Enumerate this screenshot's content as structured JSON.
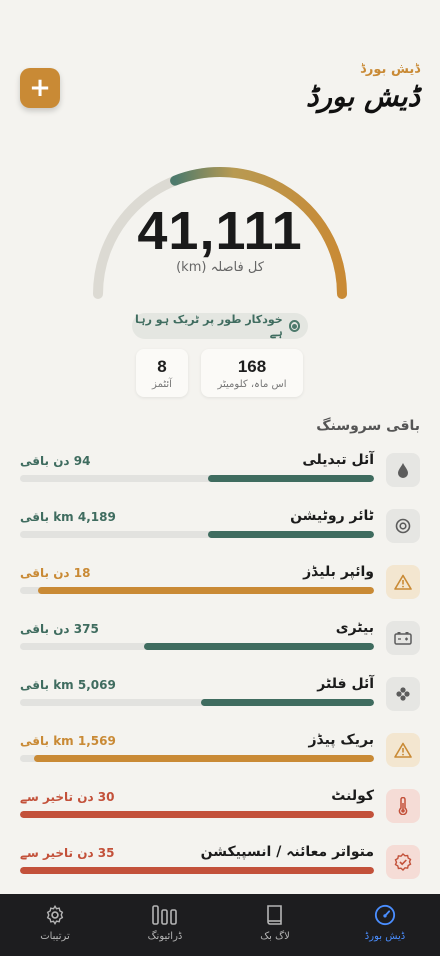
{
  "header": {
    "small_title": "ڈیش بورڈ",
    "title": "ڈیش بورڈ",
    "add_label": "+"
  },
  "odometer": {
    "value": "41,111",
    "label": "کل فاصلہ (km)",
    "gauge_fraction": 0.62
  },
  "tracking": {
    "label": "خودکار طور پر ٹریک ہو رہا ہے"
  },
  "stats": {
    "month_value": "168",
    "month_label": "اس ماہ، کلومیٹر",
    "alerts_value": "8",
    "alerts_label": "آئٹمز"
  },
  "services_title": "باقی سروسنگ",
  "services": [
    {
      "name": "آئل تبدیلی",
      "remaining": "94 دن باقی",
      "fill": 0.47,
      "color": "#3f6c5f",
      "remain_color": "#3f6c5f",
      "icon": "drop-icon",
      "icon_bg": "#e6e6e3"
    },
    {
      "name": "ٹائر روٹیشن",
      "remaining": "4,189 km باقی",
      "fill": 0.47,
      "color": "#3f6c5f",
      "remain_color": "#3f6c5f",
      "icon": "tire-icon",
      "icon_bg": "#e6e6e3"
    },
    {
      "name": "وائپر بلیڈز",
      "remaining": "18 دن باقی",
      "fill": 0.95,
      "color": "#c98a35",
      "remain_color": "#c98a35",
      "icon": "warning-icon",
      "icon_bg": "#f3e6d0"
    },
    {
      "name": "بیٹری",
      "remaining": "375 دن باقی",
      "fill": 0.65,
      "color": "#3f6c5f",
      "remain_color": "#3f6c5f",
      "icon": "battery-icon",
      "icon_bg": "#e6e6e3"
    },
    {
      "name": "آئل فلٹر",
      "remaining": "5,069 km باقی",
      "fill": 0.49,
      "color": "#3f6c5f",
      "remain_color": "#3f6c5f",
      "icon": "filter-icon",
      "icon_bg": "#e6e6e3"
    },
    {
      "name": "بریک پیڈز",
      "remaining": "1,569 km باقی",
      "fill": 0.96,
      "color": "#c98a35",
      "remain_color": "#c98a35",
      "icon": "warning-icon",
      "icon_bg": "#f3e6d0"
    },
    {
      "name": "کولنٹ",
      "remaining": "30 دن تاخیر سے",
      "fill": 1.0,
      "color": "#c3513a",
      "remain_color": "#c3513a",
      "icon": "thermometer-icon",
      "icon_bg": "#f5dcd6"
    },
    {
      "name": "متواتر معائنہ / انسپیکشن",
      "remaining": "35 دن تاخیر سے",
      "fill": 1.0,
      "color": "#c3513a",
      "remain_color": "#c3513a",
      "icon": "badge-check-icon",
      "icon_bg": "#f5dcd6"
    }
  ],
  "tabs": [
    {
      "label": "ترتیبات",
      "icon": "gear-icon"
    },
    {
      "label": "ڈرائیونگ",
      "icon": "bars-icon"
    },
    {
      "label": "لاگ بک",
      "icon": "book-icon"
    },
    {
      "label": "ڈیش بورڈ",
      "icon": "gauge-icon",
      "active": true
    }
  ],
  "colors": {
    "accent": "#c98a35",
    "green": "#3f6c5f",
    "red": "#c3513a",
    "tab_active": "#4a8eff"
  }
}
